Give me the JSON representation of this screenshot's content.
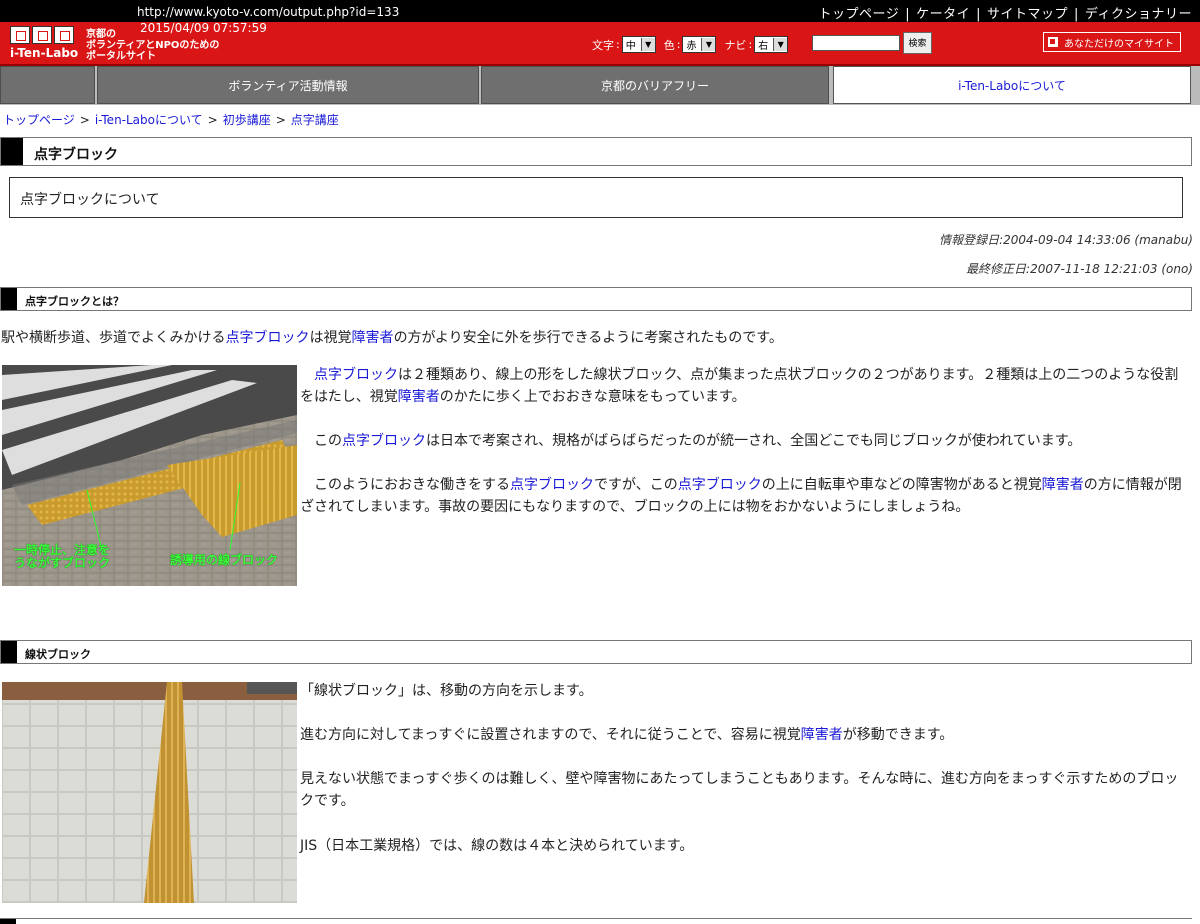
{
  "browser": {
    "url": "http://www.kyoto-v.com/output.php?id=133",
    "datetime": "2015/04/09  07:57:59"
  },
  "top_links": [
    "トップページ",
    "ケータイ",
    "サイトマップ",
    "ディクショナリー"
  ],
  "header": {
    "logo_text": "i-Ten-Labo",
    "tagline": [
      "京都の",
      "ボランティアとNPOのための",
      "ポータルサイト"
    ],
    "font_label": "文字",
    "font_value": "中",
    "color_label": "色",
    "color_value": "赤",
    "navi_label": "ナビ",
    "navi_value": "右",
    "search_placeholder": "",
    "search_button": "検索",
    "mysite_button": "あなただけのマイサイト"
  },
  "nav": {
    "items": [
      "ボランティア活動情報",
      "京都のバリアフリー",
      "i-Ten-Laboについて"
    ],
    "active_index": 2
  },
  "breadcrumb": [
    "トップページ",
    "i-Ten-Laboについて",
    "初歩講座",
    "点字講座"
  ],
  "page": {
    "title": "点字ブロック",
    "lead": "点字ブロックについて",
    "registered": "情報登録日:2004-09-04 14:33:06 (manabu)",
    "modified": "最終修正日:2007-11-18 12:21:03 (ono)"
  },
  "section1": {
    "heading": "点字ブロックとは？",
    "intro": [
      "駅や横断歩道、歩道でよくみかける",
      "点字ブロック",
      "は視覚",
      "障害者",
      "の方がより安全に外を歩行できるように考案されたものです。"
    ],
    "p1": [
      "　",
      "点字ブロック",
      "は２種類あり、線上の形をした線状ブロック、点が集まった点状ブロックの２つがあります。２種類は上の二つのような役割をはたし、視覚",
      "障害者",
      "のかたに歩く上でおおきな意味をもっています。"
    ],
    "p2": [
      "　この",
      "点字ブロック",
      "は日本で考案され、規格がばらばらだったのが統一され、全国どこでも同じブロックが使われています。"
    ],
    "p3": [
      "　このようにおおきな働きをする",
      "点字ブロック",
      "ですが、この",
      "点字ブロック",
      "の上に自転車や車などの障害物があると視覚",
      "障害者",
      "の方に情報が閉ざされてしまいます。事故の要因にもなりますので、ブロックの上には物をおかないようにしましょうね。"
    ],
    "image_labels": [
      "一時停止、注意を",
      "うながすブロック",
      "誘導用の線ブロック"
    ]
  },
  "section2": {
    "heading": "線状ブロック",
    "p1": "「線状ブロック」は、移動の方向を示します。",
    "p2": [
      "進む方向に対してまっすぐに設置されますので、それに従うことで、容易に視覚",
      "障害者",
      "が移動できます。"
    ],
    "p3": "見えない状態でまっすぐ歩くのは難しく、壁や障害物にあたってしまうこともあります。そんな時に、進む方向をまっすぐ示すためのブロックです。",
    "p4": "JIS（日本工業規格）では、線の数は４本と決められています。"
  }
}
